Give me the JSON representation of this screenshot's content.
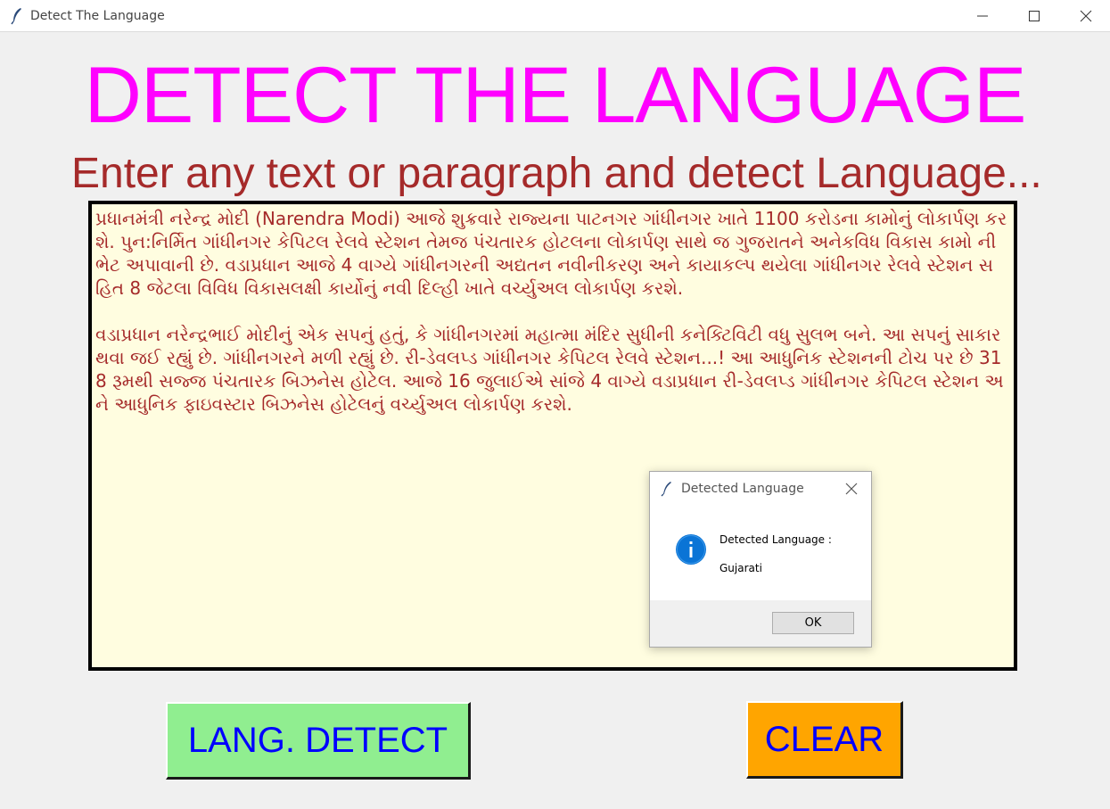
{
  "window": {
    "title": "Detect The Language"
  },
  "main": {
    "heading": "DETECT THE LANGUAGE",
    "subheading": "Enter any text or paragraph and detect Language...",
    "text_paragraphs": [
      "પ્રધાનમંત્રી નરેન્દ્ર મોદી (Narendra Modi) આજે શુક્રવારે રાજ્યના પાટનગર ગાંધીનગર ખાતે 1100 કરોડના કામોનું લોકાર્પણ કરશે. પુન:નિર્મિત ગાંધીનગર કેપિટલ રેલવે સ્ટેશન તેમજ પંચતારક હોટલના લોકાર્પણ સાથે જ ગુજરાતને અનેકવિધ વિકાસ કામો ની ભેટ અપાવાની છે. વડાપ્રધાન આજે 4 વાગ્યે ગાંધીનગરની અદ્યતન નવીનીકરણ અને કાયાકલ્પ થયેલા ગાંધીનગર રેલવે સ્ટેશન સહિત 8 જેટલા વિવિધ વિકાસલક્ષી કાર્યોનું નવી દિલ્હી ખાતે વર્ચ્યુઅલ લોકાર્પણ કરશે.",
      "વડાપ્રધાન નરેન્દ્રભાઈ મોદીનું એક સપનું હતું, કે ગાંધીનગરમાં મહાત્મા મંદિર સુધીની કનેક્ટિવિટી વધુ સુલભ બને. આ સપનું સાકાર થવા જઈ રહ્યું છે. ગાંધીનગરને મળી રહ્યું છે. રી-ડેવલપ્ડ ગાંધીનગર કેપિટલ રેલવે સ્ટેશન...! આ આધુનિક સ્ટેશનની ટોચ પર છે 318 રૂમથી સજ્જ પંચતારક બિઝનેસ હોટેલ. આજે 16 જુલાઈએ સાંજે 4 વાગ્યે વડાપ્રધાન રી-ડેવલપ્ડ ગાંધીનગર કેપિટલ સ્ટેશન અને આધુનિક ફાઇવસ્ટાર બિઝનેસ હોટેલનું વર્ચ્યુઅલ લોકાર્પણ કરશે."
    ],
    "detect_button_label": "LANG. DETECT",
    "clear_button_label": "CLEAR"
  },
  "dialog": {
    "title": "Detected Language",
    "message_label": "Detected Language :",
    "message_value": "Gujarati",
    "ok_label": "OK"
  },
  "icons": {
    "app": "feather-icon",
    "dialog_app": "feather-icon",
    "dialog_info": "info-icon",
    "minimize": "minimize-icon",
    "maximize": "maximize-icon",
    "close": "close-icon"
  },
  "colors": {
    "heading": "#ff00ff",
    "subheading": "#a52a2a",
    "text": "#a52a2a",
    "textarea_bg": "#fffde0",
    "detect_button_bg": "#90ee90",
    "clear_button_bg": "#ffa500",
    "button_text": "#0000ff",
    "info_icon": "#0a74d6"
  }
}
